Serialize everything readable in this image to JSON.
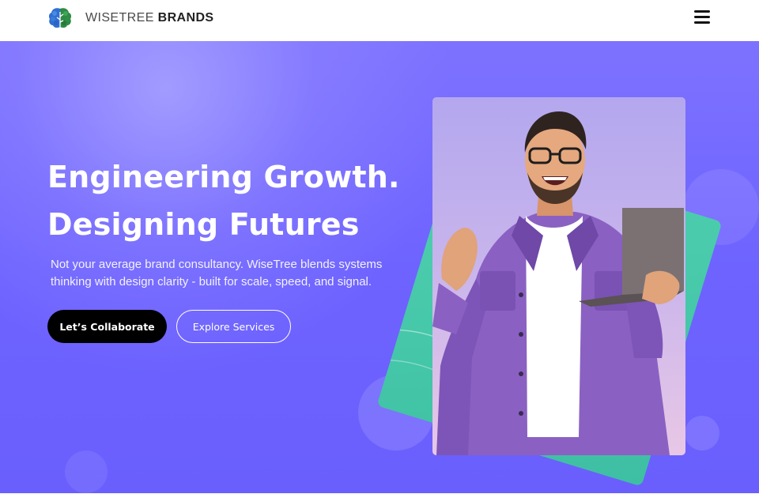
{
  "header": {
    "logo_icon": "brain-tree-logo-icon",
    "brand_light": "WISETREE",
    "brand_bold": "BRANDS",
    "menu_icon": "hamburger-menu-icon"
  },
  "hero": {
    "headline_line1": "Engineering Growth.",
    "headline_line2": "Designing Futures",
    "subtext_line1": "Not your average brand consultancy. WiseTree blends systems",
    "subtext_line2": "thinking with design clarity - built for scale, speed, and signal.",
    "primary_button": "Let’s Collaborate",
    "secondary_button": "Explore Services",
    "image": "smiling-man-with-laptop-photo"
  },
  "colors": {
    "hero_bg": "#6e63ff",
    "accent_teal": "#45c9a8",
    "primary_button_bg": "#000000",
    "text_on_hero": "#ffffff"
  }
}
